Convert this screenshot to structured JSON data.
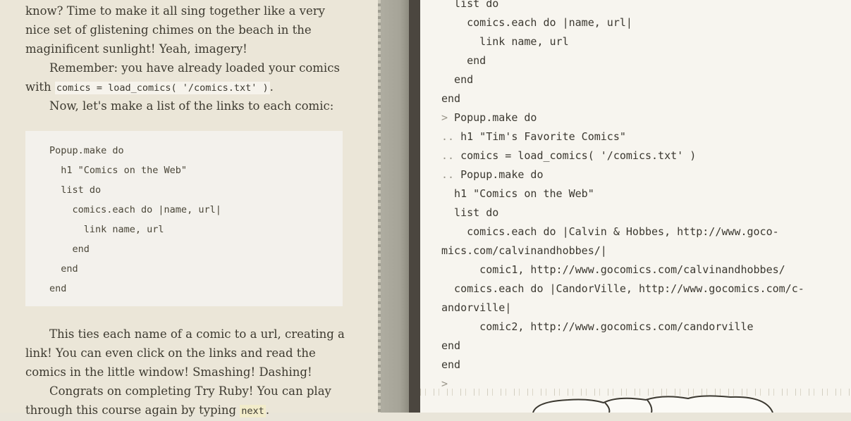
{
  "tutorial": {
    "para1": "know? Time to make it all sing together like a very nice set of glistening chimes on the beach in the maginificent sunlight! Yeah, imagery!",
    "para2_text": "Remember: you have already loaded your comics with",
    "para2_code": "comics = load_comics( '/comics.txt' )",
    "para2_end": ".",
    "para3": "Now, let's make a list of the links to each comic:",
    "code_lines": [
      "Popup.make do",
      "  h1 \"Comics on the Web\"",
      "  list do",
      "    comics.each do |name, url|",
      "      link name, url",
      "    end",
      "  end",
      "end"
    ],
    "para4": "This ties each name of a comic to a url, creating a link! You can even click on the links and read the comics in the little window! Smashing! Dashing!",
    "para5_text": "Congrats on completing Try Ruby! You can play through this course again by typing",
    "para5_code": "next",
    "para5_end": "."
  },
  "console": {
    "lines": [
      {
        "prompt": "",
        "text": "  list do"
      },
      {
        "prompt": "",
        "text": "    comics.each do |name, url|"
      },
      {
        "prompt": "",
        "text": "      link name, url"
      },
      {
        "prompt": "",
        "text": "    end"
      },
      {
        "prompt": "",
        "text": "  end"
      },
      {
        "prompt": "",
        "text": "end"
      },
      {
        "prompt": ">",
        "text": " Popup.make do"
      },
      {
        "prompt": "..",
        "text": " h1 \"Tim's Favorite Comics\""
      },
      {
        "prompt": "..",
        "text": " comics = load_comics( '/comics.txt' )"
      },
      {
        "prompt": "..",
        "text": " Popup.make do"
      },
      {
        "prompt": "",
        "text": "  h1 \"Comics on the Web\""
      },
      {
        "prompt": "",
        "text": "  list do"
      },
      {
        "prompt": "",
        "text": "    comics.each do |Calvin & Hobbes, http://www.goco-"
      },
      {
        "prompt": "",
        "text": "mics.com/calvinandhobbes/|"
      },
      {
        "prompt": "",
        "text": "      comic1, http://www.gocomics.com/calvinandhobbes/"
      },
      {
        "prompt": "",
        "text": "  comics.each do |CandorVille, http://www.gocomics.com/c-"
      },
      {
        "prompt": "",
        "text": "andorville|"
      },
      {
        "prompt": "",
        "text": "      comic2, http://www.gocomics.com/candorville"
      },
      {
        "prompt": "",
        "text": "end"
      },
      {
        "prompt": "",
        "text": "end"
      },
      {
        "prompt": ">",
        "text": ""
      }
    ]
  }
}
